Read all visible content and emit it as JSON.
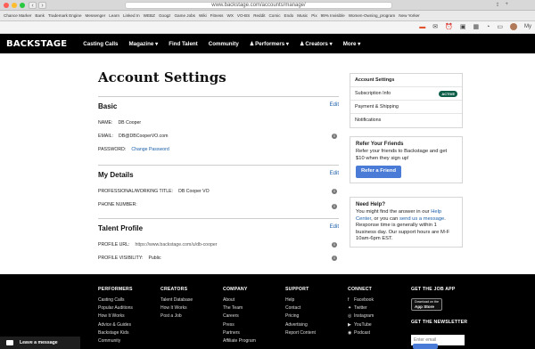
{
  "browser": {
    "url": "www.backstage.com/accounts/manage/",
    "bookmarks": [
      "Chance Marker",
      "Bank",
      "Trademark Engine",
      "Messenger",
      "Learn",
      "Linked In",
      "WEBZ",
      "Googz",
      "Game Jobs",
      "Wiki",
      "Fitness",
      "WX",
      "VO-BS",
      "Reddit",
      "Comic",
      "Endo",
      "Music",
      "Pix",
      "99% Invisible",
      "Women-Owning_program",
      "New Yorker"
    ],
    "profile_initial": "My"
  },
  "nav": {
    "logo": "BACKSTAGE",
    "items": [
      "Casting Calls",
      "Magazine",
      "Find Talent",
      "Community",
      "Performers",
      "Creators",
      "More"
    ]
  },
  "page": {
    "title": "Account Settings",
    "sections": {
      "basic": {
        "title": "Basic",
        "edit": "Edit",
        "name_label": "NAME:",
        "name_value": "DB Cooper",
        "email_label": "EMAIL:",
        "email_value": "DB@DBCooperVO.com",
        "password_label": "PASSWORD:",
        "password_link": "Change Password"
      },
      "details": {
        "title": "My Details",
        "edit": "Edit",
        "title_label": "PROFESSIONAL/WORKING TITLE:",
        "title_value": "DB Cooper VO",
        "phone_label": "PHONE NUMBER:"
      },
      "talent": {
        "title": "Talent Profile",
        "edit": "Edit",
        "url_label": "PROFILE URL:",
        "url_value": "https://www.backstage.com/u/db-cooper",
        "vis_label": "PROFILE VISIBILITY:",
        "vis_value": "Public"
      }
    }
  },
  "sidebar": {
    "menu": [
      "Account Settings",
      "Subscription Info",
      "Payment & Shipping",
      "Notifications"
    ],
    "active_badge": "ACTIVE",
    "refer": {
      "title": "Refer Your Friends",
      "text": "Refer your friends to Backstage and get $10 when they sign up!",
      "button": "Refer a Friend"
    },
    "help": {
      "title": "Need Help?",
      "text1": "You might find the answer in our ",
      "link1": "Help Center",
      "text2": ", or you can ",
      "link2": "send us a message",
      "text3": ". Response time is generally within 1 business day. Our support hours are M-F 10am-6pm EST."
    }
  },
  "footer": {
    "performers": {
      "head": "PERFORMERS",
      "links": [
        "Casting Calls",
        "Popular Auditions",
        "How It Works",
        "Advice & Guides",
        "Backstage Kids",
        "Community"
      ]
    },
    "creators": {
      "head": "CREATORS",
      "links": [
        "Talent Database",
        "How It Works",
        "Post a Job"
      ]
    },
    "company": {
      "head": "COMPANY",
      "links": [
        "About",
        "The Team",
        "Careers",
        "Press",
        "Partners",
        "Affiliate Program"
      ]
    },
    "support": {
      "head": "SUPPORT",
      "links": [
        "Help",
        "Contact",
        "Pricing",
        "Advertising",
        "Report Content"
      ]
    },
    "connect": {
      "head": "CONNECT",
      "links": [
        "Facebook",
        "Twitter",
        "Instagram",
        "YouTube",
        "Podcast"
      ]
    },
    "app": {
      "head": "GET THE JOB APP",
      "button_small": "Download on the",
      "button": "App Store"
    },
    "newsletter": {
      "head": "GET THE NEWSLETTER",
      "placeholder": "Enter email"
    },
    "leave_message": "Leave a message"
  }
}
